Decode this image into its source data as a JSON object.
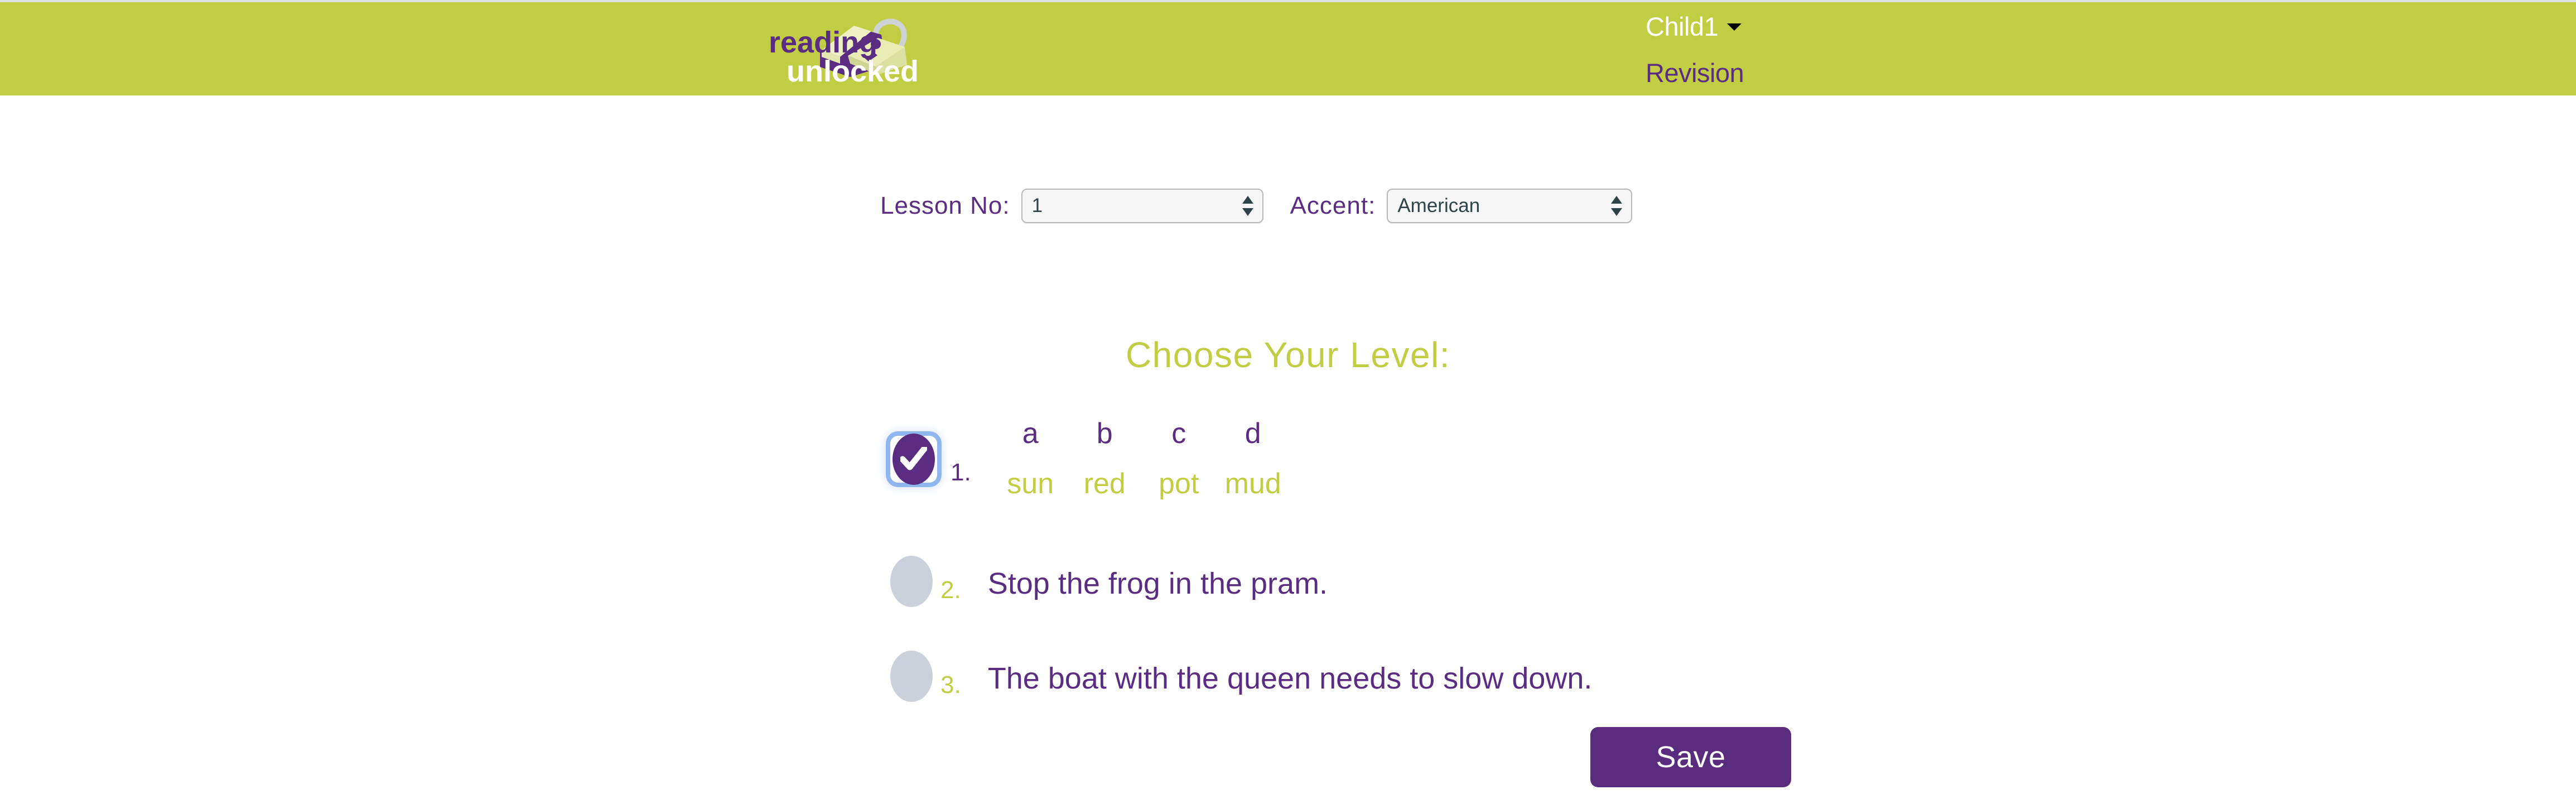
{
  "theme": {
    "brand_green": "#c1cd42",
    "brand_purple": "#5b2d82",
    "save_purple": "#5a2c7d",
    "unchecked_grey": "#ccd0da",
    "focus_blue": "#8fb6ef",
    "top_strip_grey": "#dde0e3"
  },
  "header": {
    "logo_line1": "reading",
    "logo_line2": "unlocked",
    "account_name": "Child1",
    "account_caret_icon": "chevron-down-icon",
    "mode_label": "Revision"
  },
  "controls": {
    "lesson_label": "Lesson No:",
    "lesson_value": "1",
    "accent_label": "Accent:",
    "accent_value": "American",
    "stepper_icon": "stepper-arrows-icon"
  },
  "main": {
    "heading": "Choose Your  Level:"
  },
  "levels": [
    {
      "number": "1.",
      "selected": true,
      "type": "letters",
      "letters": [
        "a",
        "b",
        "c",
        "d"
      ],
      "words": [
        "sun",
        "red",
        "pot",
        "mud"
      ]
    },
    {
      "number": "2.",
      "selected": false,
      "type": "sentence",
      "sentence": "Stop the frog in the pram."
    },
    {
      "number": "3.",
      "selected": false,
      "type": "sentence",
      "sentence": "The boat with the queen needs to slow down."
    }
  ],
  "footer": {
    "save_label": "Save"
  }
}
